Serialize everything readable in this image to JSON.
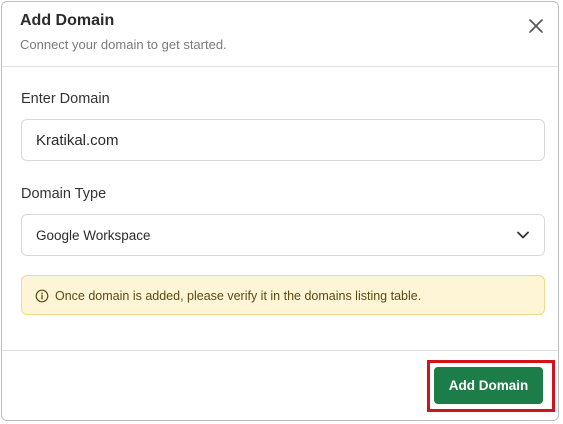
{
  "modal": {
    "title": "Add Domain",
    "subtitle": "Connect your domain to get started."
  },
  "form": {
    "domain_label": "Enter Domain",
    "domain_value": "Kratikal.com",
    "type_label": "Domain Type",
    "type_value": "Google Workspace"
  },
  "notice": {
    "text": "Once domain is added, please verify it in the domains listing table.",
    "icon": "info-icon"
  },
  "footer": {
    "submit_label": "Add Domain"
  },
  "colors": {
    "primary": "#1c7d49",
    "notice_bg": "#fdf5d6",
    "highlight": "#d3121c"
  }
}
